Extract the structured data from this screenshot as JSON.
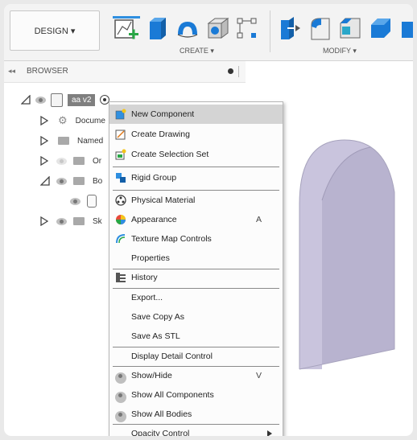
{
  "toolbar": {
    "design_label": "DESIGN ▾",
    "create_label": "CREATE ▾",
    "modify_label": "MODIFY ▾",
    "colors": {
      "accent_blue": "#2f8fe0",
      "icon_blue": "#1a7ad6"
    }
  },
  "browser": {
    "title": "BROWSER",
    "collapse_glyph": "◂◂",
    "root_label": "aa v2",
    "rows": [
      {
        "label": "Docume"
      },
      {
        "label": "Named "
      },
      {
        "label": "Or"
      },
      {
        "label": "Bo"
      },
      {
        "label": "Sk"
      }
    ]
  },
  "context_menu": {
    "items": [
      {
        "label": "New Component",
        "icon": "new-component-icon",
        "shortcut": ""
      },
      {
        "label": "Create Drawing",
        "icon": "create-drawing-icon",
        "shortcut": ""
      },
      {
        "label": "Create Selection Set",
        "icon": "selection-set-icon",
        "shortcut": ""
      },
      {
        "label": "Rigid Group",
        "icon": "rigid-group-icon",
        "shortcut": ""
      },
      {
        "label": "Physical Material",
        "icon": "physical-material-icon",
        "shortcut": ""
      },
      {
        "label": "Appearance",
        "icon": "appearance-icon",
        "shortcut": "A"
      },
      {
        "label": "Texture Map Controls",
        "icon": "texture-map-icon",
        "shortcut": ""
      },
      {
        "label": "Properties",
        "icon": "",
        "shortcut": ""
      },
      {
        "label": "History",
        "icon": "history-icon",
        "shortcut": ""
      },
      {
        "label": "Export...",
        "icon": "",
        "shortcut": ""
      },
      {
        "label": "Save Copy As",
        "icon": "",
        "shortcut": ""
      },
      {
        "label": "Save As STL",
        "icon": "",
        "shortcut": ""
      },
      {
        "label": "Display Detail Control",
        "icon": "",
        "shortcut": ""
      },
      {
        "label": "Show/Hide",
        "icon": "eye-icon",
        "shortcut": "V"
      },
      {
        "label": "Show All Components",
        "icon": "eye-icon",
        "shortcut": ""
      },
      {
        "label": "Show All Bodies",
        "icon": "eye-icon",
        "shortcut": ""
      },
      {
        "label": "Opacity Control",
        "icon": "",
        "shortcut": ""
      }
    ]
  }
}
